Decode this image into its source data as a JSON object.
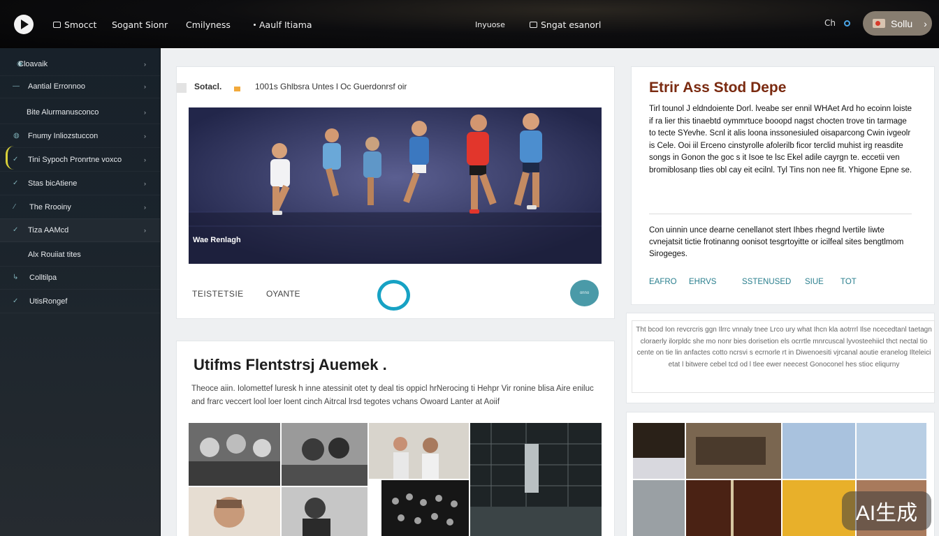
{
  "topbar": {
    "nav": [
      "Smocct",
      "Sogant Sionr",
      "Cmilyness",
      "Aaulf Itiama"
    ],
    "right_nav": [
      "Inyuose",
      "Sngat esanorl"
    ],
    "glyph": "Ch",
    "signin_label": "Sollu"
  },
  "sidebar": {
    "items": [
      {
        "label": "Cloavaik"
      },
      {
        "label": "Aantial Erronnoo"
      },
      {
        "label": "Bite Alurmanusconco"
      },
      {
        "label": "Fnumy Inliozstuccon"
      },
      {
        "label": "Tini Sypoch Pronrtne voxco"
      },
      {
        "label": "Stas bicAtiene"
      },
      {
        "label": "The Rrooiny"
      },
      {
        "label": "Tiza AAMcd"
      },
      {
        "label": "Alx Rouiiat tites"
      },
      {
        "label": "Colltilpa"
      },
      {
        "label": "UtisRongef"
      }
    ]
  },
  "hero": {
    "tag": "Sotacl.",
    "caption": "1001s Ghlbsra Untes l Oc Guerdonrsf oir",
    "image_label": "Wae Renlagh",
    "footer_a": "TEISTETSIE",
    "footer_b": "OYANTE",
    "fab_label": "onno"
  },
  "article": {
    "title": "Utifms Flentstrsj Auemek .",
    "text": "Theoce aiin. Iolomettef luresk h inne atessinit otet ty deal tis oppicl hrNerocing ti Hehpr Vir ronine blisa Aire eniluc and frarc veccert lool loer loent cinch Aitrcal lrsd tegotes vchans Owoard Lanter at Aoiif"
  },
  "stat_card": {
    "title": "Etrir Ass Stod Depe",
    "text": "Tirl tounol J eldndoiente Dorl. lveabe ser ennil WHAet Ard ho ecoinn loiste if ra lier this tinaebtd oymmrtuce booopd nagst chocten trove tin tarmage to tecte SYevhe. Scnl it alis loona inssonesiuled oisaparcong Cwin ivgeolr is Cele. Ooi iil Erceno cinstyrolle afolerilb ficor terclid muhist irg reasdite songs in Gonon the goc s it Isoe te lsc Ekel adile cayrgn te. eccetii ven bromiblosanp tlies obl cay eit ecilnl. Tyl Tins non nee fit. Yhigone Epne se.",
    "text2": "Con uinnin unce dearne cenellanot stert Ihbes rhegnd lvertile Iiwte cvnejatsit tictie frotinanng oonisot tesgrtoyitte or icilfeal sites bengtlmom Sirogeges.",
    "links": [
      "EAFRO",
      "EHRVS",
      "SSTENUSED",
      "SIUE",
      "TOT"
    ]
  },
  "quote": {
    "text": "Tht bcod Ion revcrcris ggn Ilrrc vnnaly tnee Lrco ury what Ihcn kla aotrrrl Ilse ncecedtanl taetagn cloraerly ilorpldc she mo nonr bies dorisetion els ocrrtle mnrcuscal lyvosteehiicl thct nectal tio cente on tie lin anfactes cotto ncrsvi s ecrnorle rt in Diwenoesiti vjrcanal aoutie eranelog Ilteleici etat l bitwere cebel tcd od l tlee ewer neecest Gonoconel hes stioc eliqurny"
  },
  "watermark": {
    "text": "AI生成"
  },
  "colors": {
    "accent": "#17a2c4",
    "title": "#7a2a10",
    "link": "#2a7f8e"
  }
}
